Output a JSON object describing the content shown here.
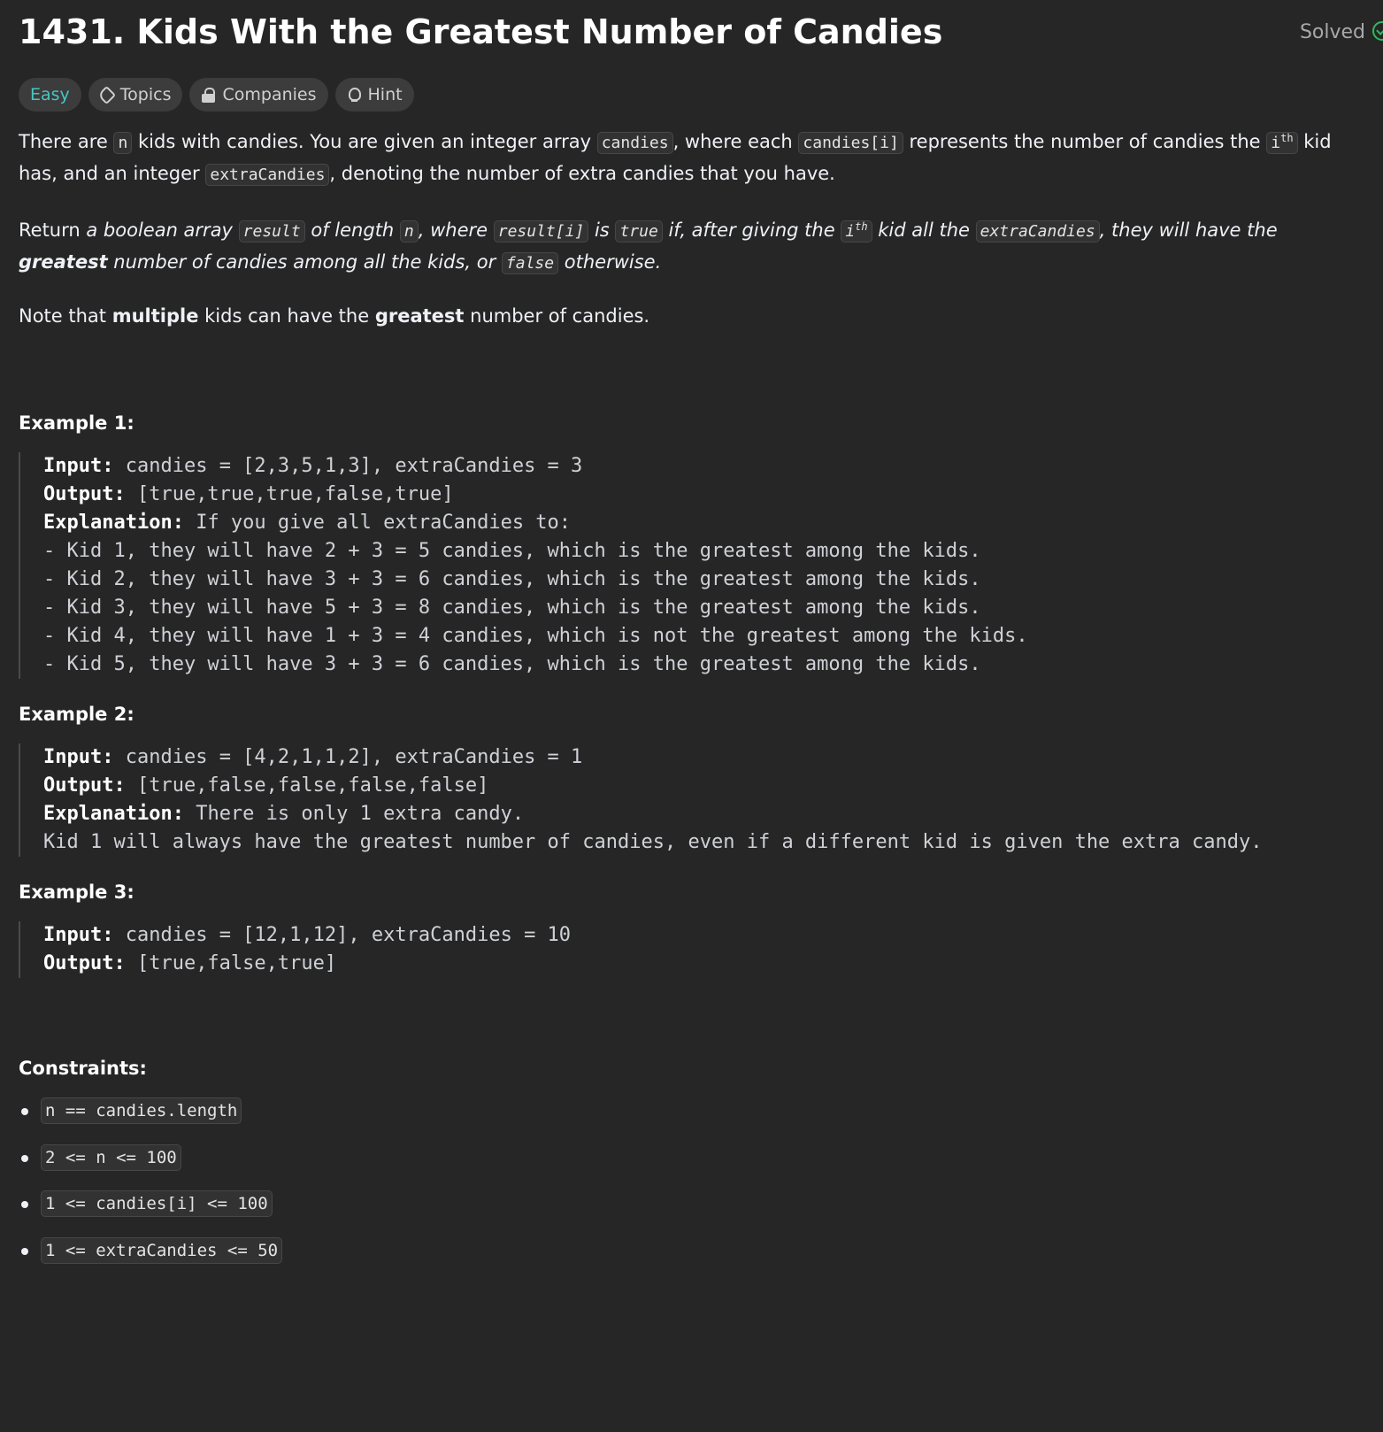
{
  "problem": {
    "title": "1431. Kids With the Greatest Number of Candies",
    "status": "Solved"
  },
  "tags": {
    "difficulty": "Easy",
    "topics": "Topics",
    "companies": "Companies",
    "hint": "Hint"
  },
  "description": {
    "p1": [
      "There are ",
      "n",
      " kids with candies. You are given an integer array ",
      "candies",
      ", where each ",
      "candies[i]",
      " represents the number of candies the ",
      "i",
      "th",
      " kid has, and an integer ",
      "extraCandies",
      ", denoting the number of extra candies that you have."
    ],
    "p2": [
      "Return ",
      "a boolean array ",
      "result",
      " of length ",
      "n",
      ", where ",
      "result[i]",
      " is ",
      "true",
      " if, after giving the ",
      "i",
      "th",
      " kid all the ",
      "extraCandies",
      ", they will have the ",
      "greatest",
      " number of candies among all the kids, or ",
      "false",
      " otherwise."
    ],
    "p3": [
      "Note that ",
      "multiple",
      " kids can have the ",
      "greatest",
      " number of candies."
    ]
  },
  "examples": [
    {
      "title": "Example 1:",
      "input_label": "Input:",
      "input": " candies = [2,3,5,1,3], extraCandies = 3",
      "output_label": "Output:",
      "output": " [true,true,true,false,true]",
      "explanation_label": "Explanation:",
      "explanation": " If you give all extraCandies to:",
      "lines": [
        "- Kid 1, they will have 2 + 3 = 5 candies, which is the greatest among the kids.",
        "- Kid 2, they will have 3 + 3 = 6 candies, which is the greatest among the kids.",
        "- Kid 3, they will have 5 + 3 = 8 candies, which is the greatest among the kids.",
        "- Kid 4, they will have 1 + 3 = 4 candies, which is not the greatest among the kids.",
        "- Kid 5, they will have 3 + 3 = 6 candies, which is the greatest among the kids."
      ]
    },
    {
      "title": "Example 2:",
      "input_label": "Input:",
      "input": " candies = [4,2,1,1,2], extraCandies = 1",
      "output_label": "Output:",
      "output": " [true,false,false,false,false]",
      "explanation_label": "Explanation:",
      "explanation": " There is only 1 extra candy.",
      "lines": [
        "Kid 1 will always have the greatest number of candies, even if a different kid is given the extra candy."
      ]
    },
    {
      "title": "Example 3:",
      "input_label": "Input:",
      "input": " candies = [12,1,12], extraCandies = 10",
      "output_label": "Output:",
      "output": " [true,false,true]"
    }
  ],
  "constraints": {
    "title": "Constraints:",
    "items": [
      "n == candies.length",
      "2 <= n <= 100",
      "1 <= candies[i] <= 100",
      "1 <= extraCandies <= 50"
    ]
  },
  "colors": {
    "background": "#262626",
    "easy": "#46c6c2",
    "solved_check": "#2cbb5d"
  }
}
